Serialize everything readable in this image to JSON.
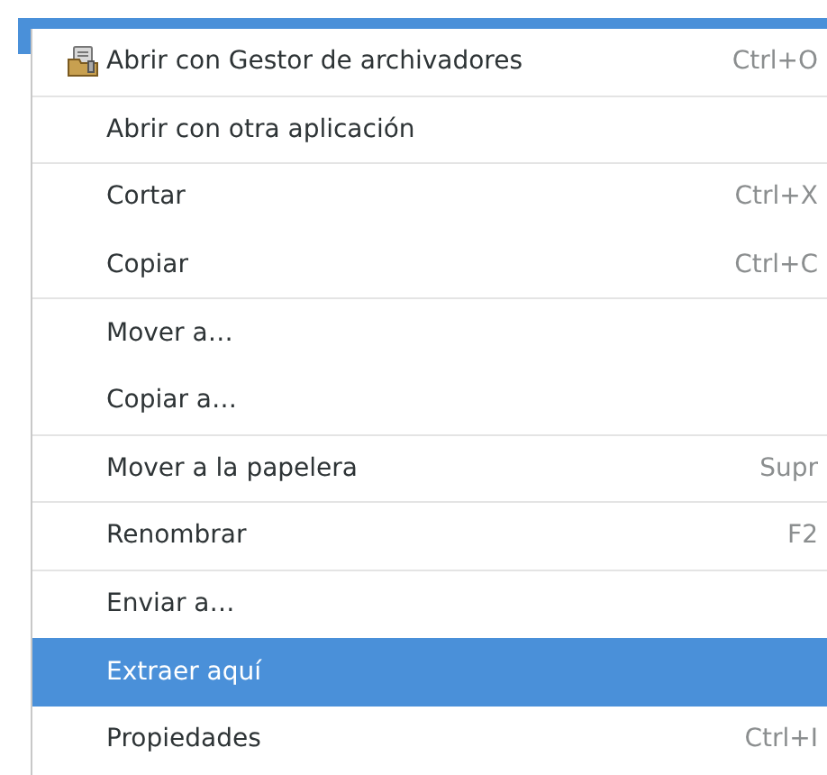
{
  "menu": {
    "items": [
      {
        "kind": "icon",
        "label": "Abrir con Gestor de archivadores",
        "shortcut": "Ctrl+O",
        "selected": false,
        "separator": true
      },
      {
        "kind": "plain",
        "label": "Abrir con otra aplicación",
        "selected": false,
        "separator": true
      },
      {
        "kind": "plain",
        "label": "Cortar",
        "shortcut": "Ctrl+X",
        "selected": false,
        "separator": false
      },
      {
        "kind": "plain",
        "label": "Copiar",
        "shortcut": "Ctrl+C",
        "selected": false,
        "separator": true
      },
      {
        "kind": "plain",
        "label": "Mover a…",
        "selected": false,
        "separator": false
      },
      {
        "kind": "plain",
        "label": "Copiar a…",
        "selected": false,
        "separator": true
      },
      {
        "kind": "plain",
        "label": "Mover a la papelera",
        "shortcut": "Supr",
        "selected": false,
        "separator": true
      },
      {
        "kind": "plain",
        "label": "Renombrar",
        "shortcut": "F2",
        "selected": false,
        "separator": true
      },
      {
        "kind": "plain",
        "label": "Enviar a…",
        "selected": false,
        "separator": false
      },
      {
        "kind": "plain",
        "label": "Extraer aquí",
        "selected": true,
        "separator": false
      },
      {
        "kind": "plain",
        "label": "Propiedades",
        "shortcut": "Ctrl+I",
        "selected": false,
        "separator": false
      }
    ]
  }
}
